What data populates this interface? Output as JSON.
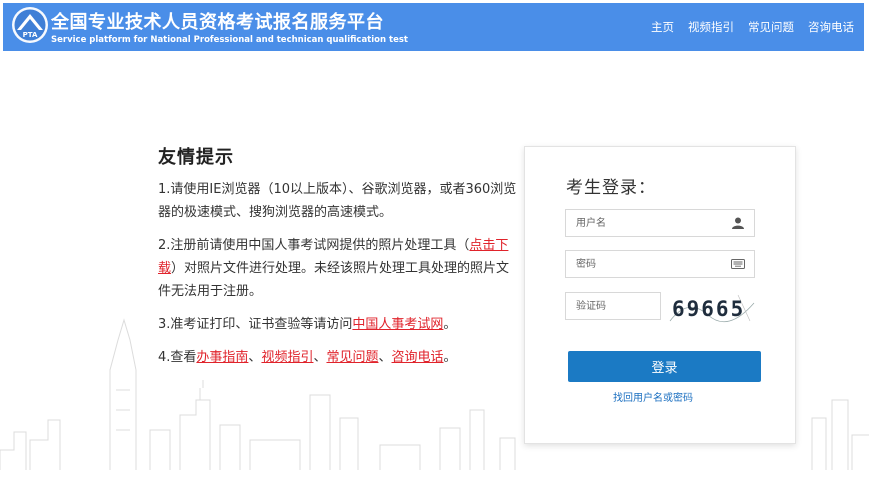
{
  "header": {
    "title_cn": "全国专业技术人员资格考试报名服务平台",
    "title_en": "Service platform for National Professional and technican qualification test",
    "logo_text": "PTA",
    "nav": [
      "主页",
      "视频指引",
      "常见问题",
      "咨询电话"
    ]
  },
  "tips": {
    "heading": "友情提示",
    "item1": "1.请使用IE浏览器（10以上版本）、谷歌浏览器，或者360浏览器的极速模式、搜狗浏览器的高速模式。",
    "item2_pre": "2.注册前请使用中国人事考试网提供的照片处理工具（",
    "item2_link": "点击下载",
    "item2_post": "）对照片文件进行处理。未经该照片处理工具处理的照片文件无法用于注册。",
    "item3_pre": "3.准考证打印、证书查验等请访问",
    "item3_link": "中国人事考试网",
    "item3_post": "。",
    "item4_pre": "4.查看",
    "item4_links": [
      "办事指南",
      "视频指引",
      "常见问题",
      "咨询电话"
    ],
    "item4_sep": "、",
    "item4_post": "。"
  },
  "login": {
    "title": "考生登录：",
    "username_placeholder": "用户名",
    "password_placeholder": "密码",
    "captcha_placeholder": "验证码",
    "captcha_code": "69665",
    "button": "登录",
    "forgot": "找回用户名或密码"
  },
  "colors": {
    "header_bg": "#4a8ee8",
    "button_bg": "#1b7ac4",
    "link_red": "#e0232b",
    "link_blue": "#1b6fc0"
  }
}
